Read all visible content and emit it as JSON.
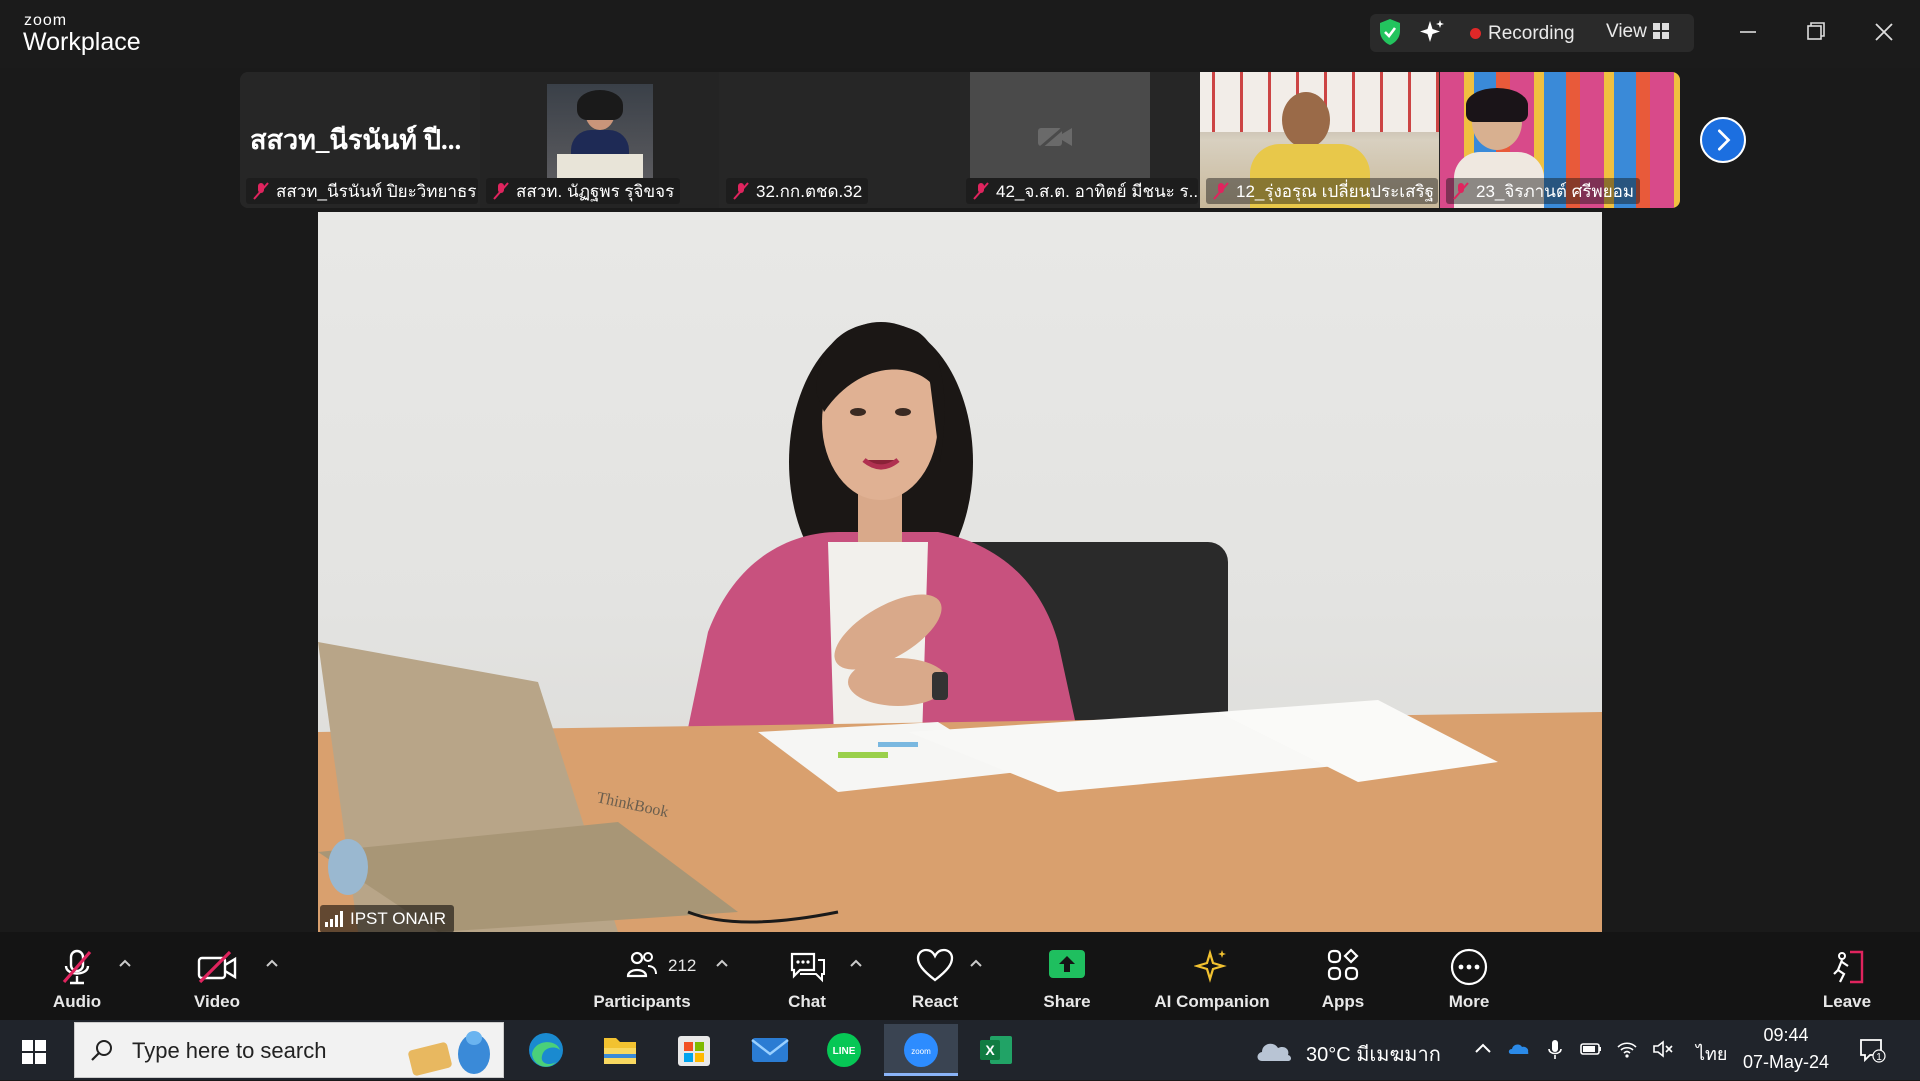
{
  "app": {
    "brand_top": "zoom",
    "brand_bottom": "Workplace"
  },
  "status": {
    "recording_label": "Recording",
    "view_label": "View"
  },
  "strip": {
    "big_name": "สสวท_นีรนันท์ ปี...",
    "tiles": [
      {
        "name": "สสวท_นีรนันท์ ปิยะวิทยาธร...",
        "muted": true,
        "video": "off"
      },
      {
        "name": "สสวท. นัฏฐพร รุจิขจร",
        "muted": true,
        "video": "on"
      },
      {
        "name": "32.กก.ตชด.32",
        "muted": true,
        "video": "off"
      },
      {
        "name": "42_จ.ส.ต. อาทิตย์ มีชนะ ร...",
        "muted": true,
        "video": "off"
      },
      {
        "name": "12_รุ่งอรุณ  เปลี่ยนประเสริฐ",
        "muted": true,
        "video": "on"
      },
      {
        "name": "23_จิรภานต์ ศรีพยอม",
        "muted": true,
        "video": "on"
      }
    ]
  },
  "main_video": {
    "name": "IPST ONAIR"
  },
  "toolbar": {
    "audio": "Audio",
    "video": "Video",
    "participants": "Participants",
    "participant_count": "212",
    "chat": "Chat",
    "react": "React",
    "share": "Share",
    "ai_companion": "AI Companion",
    "apps": "Apps",
    "more": "More",
    "leave": "Leave"
  },
  "taskbar": {
    "search_placeholder": "Type here to search",
    "weather": "30°C  มีเมฆมาก",
    "language": "ไทย",
    "time": "09:44",
    "date": "07-May-24",
    "notification_count": "1"
  },
  "colors": {
    "accent": "#1c6fe0",
    "recording": "#e02828",
    "share": "#1fbf5f",
    "mute": "#e0245e"
  }
}
